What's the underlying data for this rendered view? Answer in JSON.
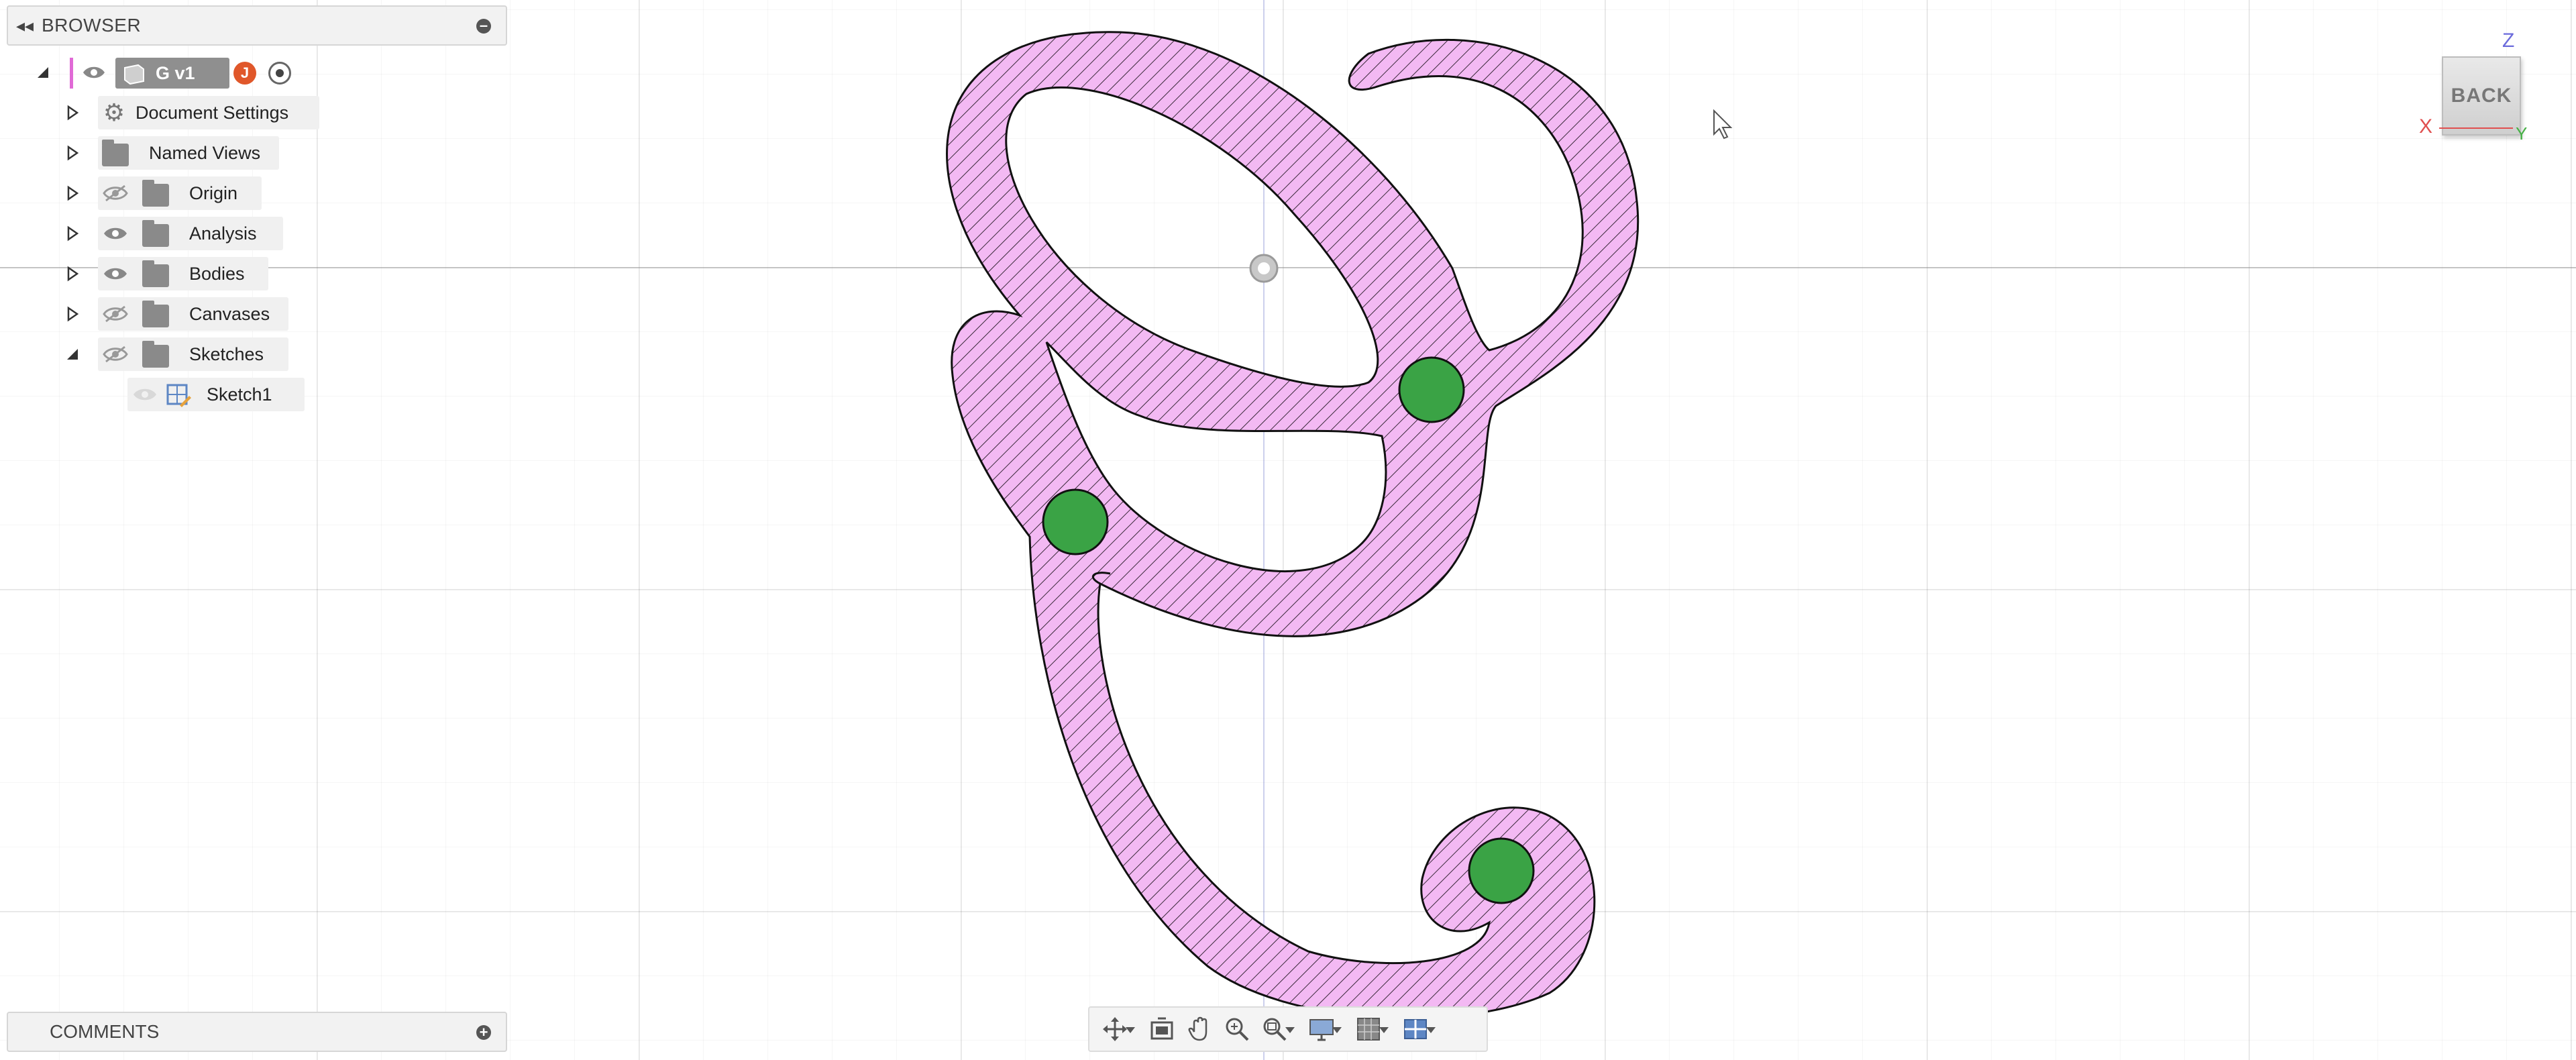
{
  "browser": {
    "title": "BROWSER",
    "root": {
      "label": "G v1",
      "badge": "J"
    },
    "items": [
      {
        "label": "Document Settings",
        "icon": "gear-icon",
        "visibility": "none"
      },
      {
        "label": "Named Views",
        "icon": "folder-icon",
        "visibility": "none"
      },
      {
        "label": "Origin",
        "icon": "folder-icon",
        "visibility": "hidden"
      },
      {
        "label": "Analysis",
        "icon": "folder-icon",
        "visibility": "visible"
      },
      {
        "label": "Bodies",
        "icon": "folder-icon",
        "visibility": "visible"
      },
      {
        "label": "Canvases",
        "icon": "folder-icon",
        "visibility": "hidden"
      },
      {
        "label": "Sketches",
        "icon": "folder-icon",
        "visibility": "hidden",
        "expanded": true
      }
    ],
    "sketch_child": {
      "label": "Sketch1",
      "icon": "sketch-icon"
    }
  },
  "comments": {
    "title": "COMMENTS"
  },
  "viewcube": {
    "face": "BACK",
    "axis_z": "Z",
    "axis_x": "X",
    "axis_y": "Y"
  },
  "toolbar": {
    "buttons": [
      "orbit-icon",
      "look-at-icon",
      "pan-icon",
      "zoom-icon",
      "zoom-window-icon",
      "display-settings-icon",
      "grid-settings-icon",
      "viewports-icon"
    ]
  },
  "colors": {
    "profile_fill": "#f3b9f3",
    "hole_fill": "#3aa345",
    "accent_badge": "#e0572a",
    "root_bar": "#e06ad6"
  }
}
